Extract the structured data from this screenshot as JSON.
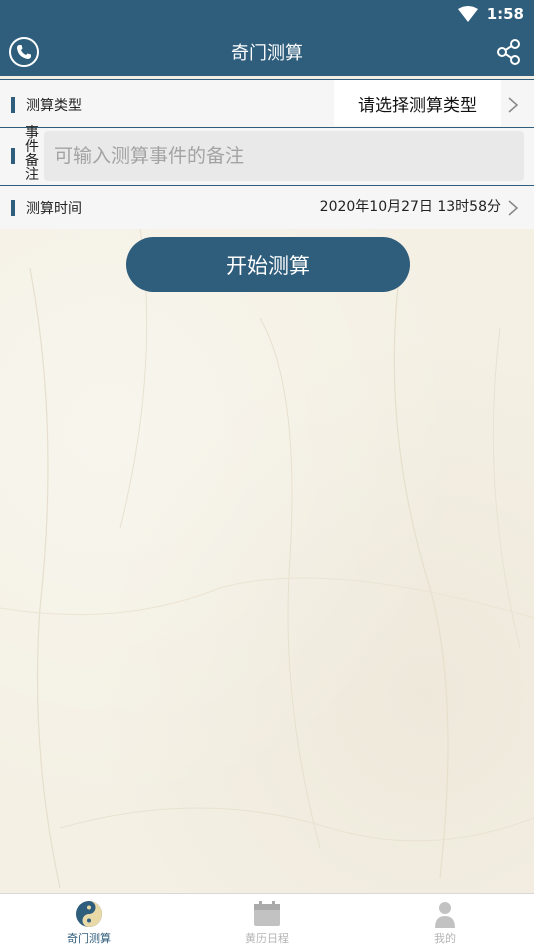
{
  "status_bar": {
    "time": "1:58"
  },
  "app_bar": {
    "title": "奇门测算"
  },
  "form": {
    "type_label": "测算类型",
    "type_value": "请选择测算类型",
    "note_label": "事件备注",
    "note_placeholder": "可输入测算事件的备注",
    "time_label": "测算时间",
    "time_value": "2020年10月27日 13时58分"
  },
  "start_button": "开始测算",
  "bottom_nav": {
    "items": [
      {
        "label": "奇门测算",
        "active": true
      },
      {
        "label": "黄历日程",
        "active": false
      },
      {
        "label": "我的",
        "active": false
      }
    ]
  },
  "colors": {
    "primary": "#2f5d7c",
    "inactive": "#b5b5b5"
  }
}
